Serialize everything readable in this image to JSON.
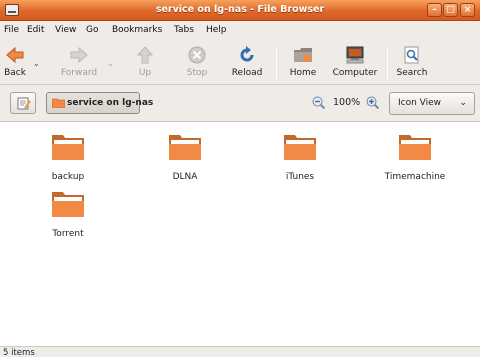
{
  "window": {
    "title": "service on lg-nas - File Browser"
  },
  "menu": {
    "items": [
      "File",
      "Edit",
      "View",
      "Go",
      "Bookmarks",
      "Tabs",
      "Help"
    ]
  },
  "toolbar": {
    "back": "Back",
    "forward": "Forward",
    "up": "Up",
    "stop": "Stop",
    "reload": "Reload",
    "home": "Home",
    "computer": "Computer",
    "search": "Search"
  },
  "location": {
    "path_label": "service on lg-nas",
    "zoom": "100%",
    "view_mode": "Icon View"
  },
  "folders": [
    {
      "name": "backup"
    },
    {
      "name": "DLNA"
    },
    {
      "name": "iTunes"
    },
    {
      "name": "Timemachine"
    },
    {
      "name": "Torrent"
    }
  ],
  "status": {
    "text": "5 items"
  },
  "colors": {
    "title_orange": "#e0682a",
    "folder_orange": "#f08a45",
    "chrome": "#efebe7"
  }
}
